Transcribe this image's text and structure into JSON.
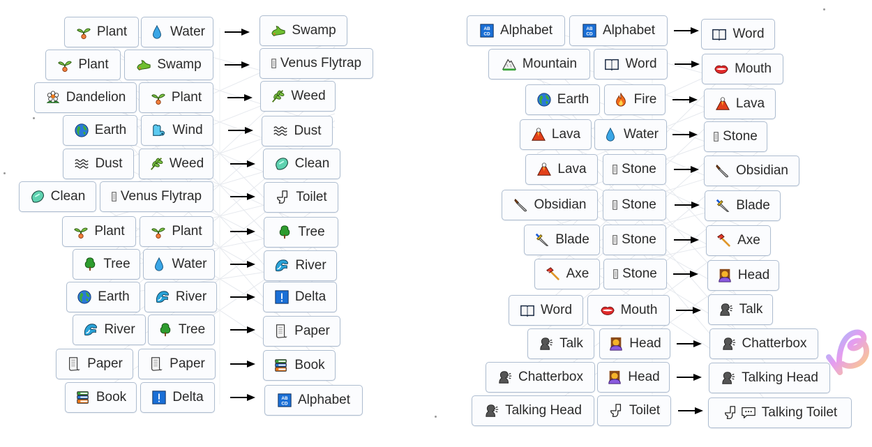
{
  "colors": {
    "box_border": "#aebdd0",
    "box_background": "#fbfcfe",
    "text": "#2b2b2b",
    "arrow": "#000000"
  },
  "left_panel": {
    "recipes": [
      {
        "a": {
          "label": "Plant",
          "icon": "seedling-icon"
        },
        "b": {
          "label": "Water",
          "icon": "droplet-icon"
        },
        "result": {
          "label": "Swamp",
          "icon": "crocodile-icon"
        }
      },
      {
        "a": {
          "label": "Plant",
          "icon": "seedling-icon"
        },
        "b": {
          "label": "Swamp",
          "icon": "crocodile-icon"
        },
        "result": {
          "label": "Venus Flytrap",
          "icon": "missing-glyph-icon"
        }
      },
      {
        "a": {
          "label": "Dandelion",
          "icon": "flower-icon"
        },
        "b": {
          "label": "Plant",
          "icon": "seedling-icon"
        },
        "result": {
          "label": "Weed",
          "icon": "herb-icon"
        }
      },
      {
        "a": {
          "label": "Earth",
          "icon": "globe-icon"
        },
        "b": {
          "label": "Wind",
          "icon": "wind-face-icon"
        },
        "result": {
          "label": "Dust",
          "icon": "fog-icon"
        }
      },
      {
        "a": {
          "label": "Dust",
          "icon": "fog-icon"
        },
        "b": {
          "label": "Weed",
          "icon": "herb-icon"
        },
        "result": {
          "label": "Clean",
          "icon": "soap-icon"
        }
      },
      {
        "a": {
          "label": "Clean",
          "icon": "soap-icon"
        },
        "b": {
          "label": "Venus Flytrap",
          "icon": "missing-glyph-icon"
        },
        "result": {
          "label": "Toilet",
          "icon": "toilet-icon"
        }
      },
      {
        "a": {
          "label": "Plant",
          "icon": "seedling-icon"
        },
        "b": {
          "label": "Plant",
          "icon": "seedling-icon"
        },
        "result": {
          "label": "Tree",
          "icon": "tree-icon"
        }
      },
      {
        "a": {
          "label": "Tree",
          "icon": "tree-icon"
        },
        "b": {
          "label": "Water",
          "icon": "droplet-icon"
        },
        "result": {
          "label": "River",
          "icon": "wave-icon"
        }
      },
      {
        "a": {
          "label": "Earth",
          "icon": "globe-icon"
        },
        "b": {
          "label": "River",
          "icon": "wave-icon"
        },
        "result": {
          "label": "Delta",
          "icon": "delta-icon"
        }
      },
      {
        "a": {
          "label": "River",
          "icon": "wave-icon"
        },
        "b": {
          "label": "Tree",
          "icon": "tree-icon"
        },
        "result": {
          "label": "Paper",
          "icon": "scroll-icon"
        }
      },
      {
        "a": {
          "label": "Paper",
          "icon": "scroll-icon"
        },
        "b": {
          "label": "Paper",
          "icon": "scroll-icon"
        },
        "result": {
          "label": "Book",
          "icon": "books-icon"
        }
      },
      {
        "a": {
          "label": "Book",
          "icon": "books-icon"
        },
        "b": {
          "label": "Delta",
          "icon": "delta-icon"
        },
        "result": {
          "label": "Alphabet",
          "icon": "abcd-icon"
        }
      }
    ]
  },
  "right_panel": {
    "recipes": [
      {
        "a": {
          "label": "Alphabet",
          "icon": "abcd-icon"
        },
        "b": {
          "label": "Alphabet",
          "icon": "abcd-icon"
        },
        "result": {
          "label": "Word",
          "icon": "open-book-icon"
        }
      },
      {
        "a": {
          "label": "Mountain",
          "icon": "mountain-icon"
        },
        "b": {
          "label": "Word",
          "icon": "open-book-icon"
        },
        "result": {
          "label": "Mouth",
          "icon": "lips-icon"
        }
      },
      {
        "a": {
          "label": "Earth",
          "icon": "globe-icon"
        },
        "b": {
          "label": "Fire",
          "icon": "fire-icon"
        },
        "result": {
          "label": "Lava",
          "icon": "volcano-icon"
        }
      },
      {
        "a": {
          "label": "Lava",
          "icon": "volcano-icon"
        },
        "b": {
          "label": "Water",
          "icon": "droplet-icon"
        },
        "result": {
          "label": "Stone",
          "icon": "missing-glyph-icon"
        }
      },
      {
        "a": {
          "label": "Lava",
          "icon": "volcano-icon"
        },
        "b": {
          "label": "Stone",
          "icon": "missing-glyph-icon"
        },
        "result": {
          "label": "Obsidian",
          "icon": "knife-icon"
        }
      },
      {
        "a": {
          "label": "Obsidian",
          "icon": "knife-icon"
        },
        "b": {
          "label": "Stone",
          "icon": "missing-glyph-icon"
        },
        "result": {
          "label": "Blade",
          "icon": "dagger-icon"
        }
      },
      {
        "a": {
          "label": "Blade",
          "icon": "dagger-icon"
        },
        "b": {
          "label": "Stone",
          "icon": "missing-glyph-icon"
        },
        "result": {
          "label": "Axe",
          "icon": "axe-icon"
        }
      },
      {
        "a": {
          "label": "Axe",
          "icon": "axe-icon"
        },
        "b": {
          "label": "Stone",
          "icon": "missing-glyph-icon"
        },
        "result": {
          "label": "Head",
          "icon": "woman-head-icon"
        }
      },
      {
        "a": {
          "label": "Word",
          "icon": "open-book-icon"
        },
        "b": {
          "label": "Mouth",
          "icon": "lips-icon"
        },
        "result": {
          "label": "Talk",
          "icon": "speaking-head-icon"
        }
      },
      {
        "a": {
          "label": "Talk",
          "icon": "speaking-head-icon"
        },
        "b": {
          "label": "Head",
          "icon": "woman-head-icon"
        },
        "result": {
          "label": "Chatterbox",
          "icon": "speaking-head-icon"
        }
      },
      {
        "a": {
          "label": "Chatterbox",
          "icon": "speaking-head-icon"
        },
        "b": {
          "label": "Head",
          "icon": "woman-head-icon"
        },
        "result": {
          "label": "Talking Head",
          "icon": "speaking-head-icon"
        }
      },
      {
        "a": {
          "label": "Talking Head",
          "icon": "speaking-head-icon"
        },
        "b": {
          "label": "Toilet",
          "icon": "toilet-icon"
        },
        "result": {
          "label": "Talking Toilet",
          "icon": "toilet-icon",
          "icon2": "speech-bubble-icon"
        }
      }
    ]
  },
  "watermark": {
    "icon": "brand-logo-icon"
  }
}
